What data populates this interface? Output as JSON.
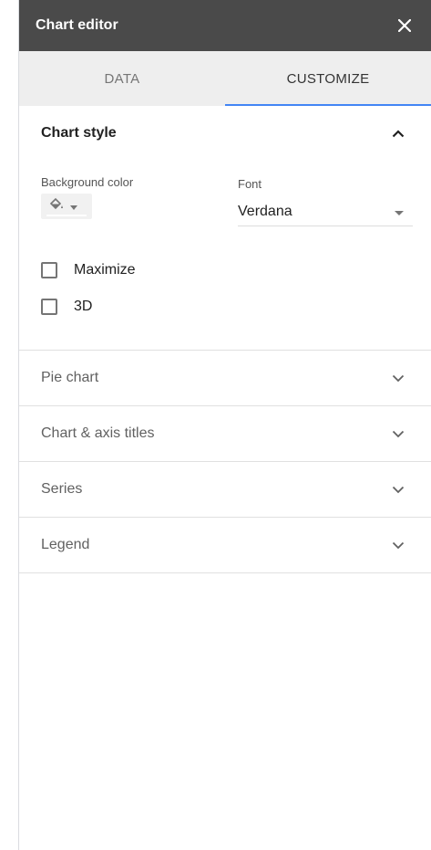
{
  "header": {
    "title": "Chart editor",
    "close_icon": "close-icon"
  },
  "tabs": [
    {
      "label": "DATA",
      "active": false
    },
    {
      "label": "CUSTOMIZE",
      "active": true
    }
  ],
  "chart_style": {
    "title": "Chart style",
    "expanded": true,
    "background_color": {
      "label": "Background color",
      "icon": "paint-bucket-icon",
      "value_color": "#ffffff"
    },
    "font": {
      "label": "Font",
      "value": "Verdana"
    },
    "checkboxes": [
      {
        "label": "Maximize",
        "checked": false
      },
      {
        "label": "3D",
        "checked": false
      }
    ]
  },
  "sections": [
    {
      "label": "Pie chart",
      "expanded": false
    },
    {
      "label": "Chart & axis titles",
      "expanded": false
    },
    {
      "label": "Series",
      "expanded": false
    },
    {
      "label": "Legend",
      "expanded": false
    }
  ],
  "colors": {
    "header_bg": "#4a4a4a",
    "tab_bg": "#eeeeee",
    "accent": "#4285f4"
  }
}
